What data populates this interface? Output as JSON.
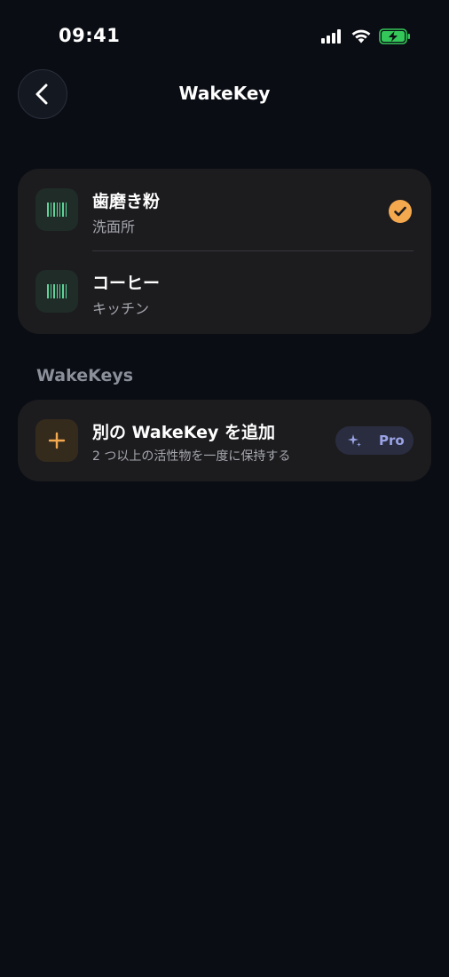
{
  "status_bar": {
    "time": "09:41",
    "signal_icon": "cellular-signal-icon",
    "wifi_icon": "wifi-icon",
    "battery_icon": "battery-charging-icon"
  },
  "nav": {
    "back_icon": "chevron-left-icon",
    "title": "WakeKey"
  },
  "items": [
    {
      "title": "歯磨き粉",
      "subtitle": "洗面所",
      "icon": "barcode-icon",
      "selected": true
    },
    {
      "title": "コーヒー",
      "subtitle": "キッチン",
      "icon": "barcode-icon",
      "selected": false
    }
  ],
  "section": {
    "label": "WakeKeys"
  },
  "add_wakekey": {
    "title": "別の WakeKey を追加",
    "subtitle": "2 つ以上の活性物を一度に保持する",
    "icon": "plus-icon",
    "badge_icon": "sparkle-icon",
    "badge_label": "Pro"
  },
  "colors": {
    "background": "#0a0d14",
    "card": "#1c1c1f",
    "accent_orange": "#f5a94f",
    "barcode_green": "#5fd39a",
    "pro_text": "#9aa3e6"
  }
}
